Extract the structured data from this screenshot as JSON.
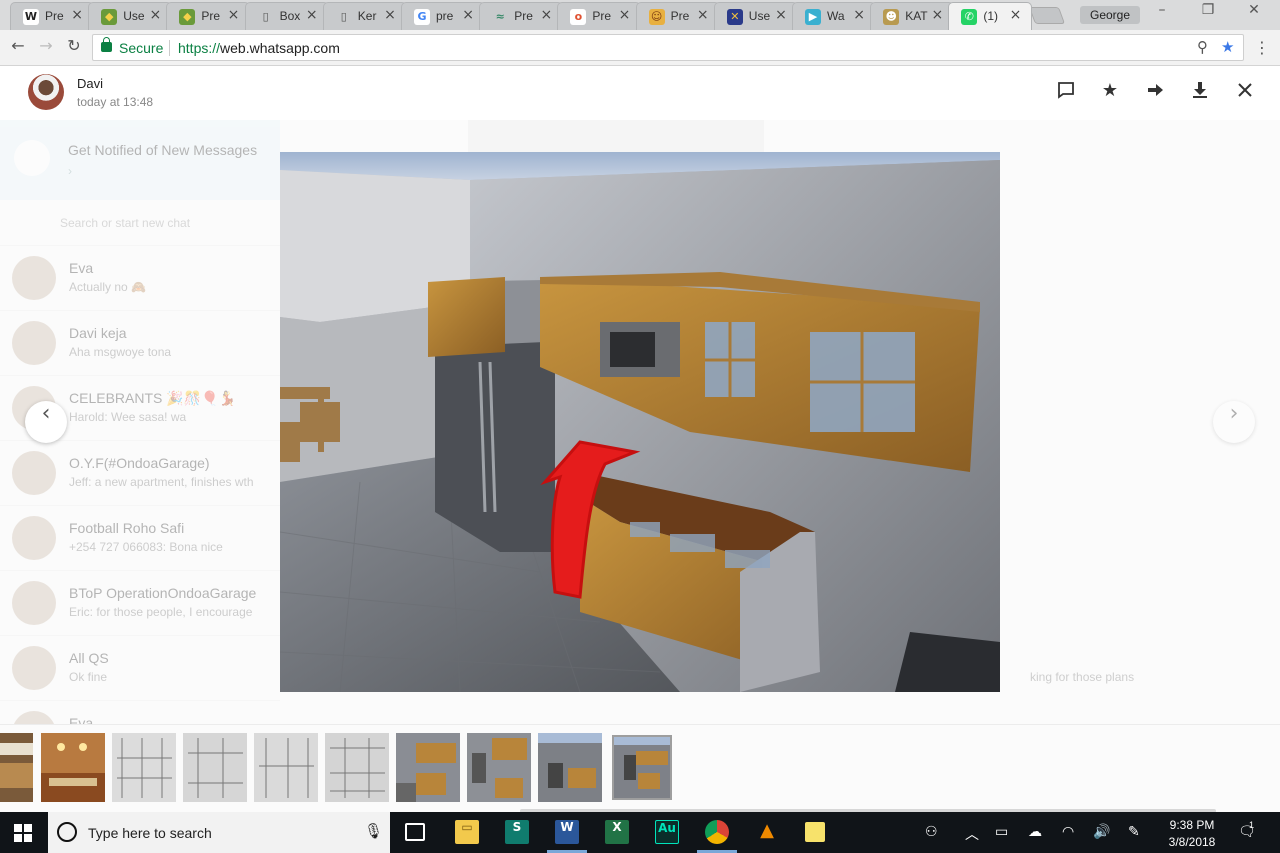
{
  "browser": {
    "tabs": [
      {
        "title": "Pre",
        "icon": "W",
        "color": "#ffffff",
        "fg": "#222222"
      },
      {
        "title": "Use",
        "icon": "◆",
        "color": "#6a9a3a",
        "fg": "#f4d04a"
      },
      {
        "title": "Pre",
        "icon": "◆",
        "color": "#6a9a3a",
        "fg": "#f4d04a"
      },
      {
        "title": "Box",
        "icon": "▯",
        "color": "#c8cacc",
        "fg": "#555555"
      },
      {
        "title": "Ker",
        "icon": "▯",
        "color": "#c8cacc",
        "fg": "#555555"
      },
      {
        "title": "pre",
        "icon": "G",
        "color": "#ffffff",
        "fg": "#4285f4"
      },
      {
        "title": "Pre",
        "icon": "≈",
        "color": "#c8cacc",
        "fg": "#3a8a6a"
      },
      {
        "title": "Pre",
        "icon": "o",
        "color": "#ffffff",
        "fg": "#e05030"
      },
      {
        "title": "Pre",
        "icon": "☺",
        "color": "#e8b040",
        "fg": "#7a3a10"
      },
      {
        "title": "Use",
        "icon": "✕",
        "color": "#2a3a8a",
        "fg": "#f0c040"
      },
      {
        "title": "Wa",
        "icon": "▶",
        "color": "#3ab0d0",
        "fg": "#ffffff"
      },
      {
        "title": "KAT",
        "icon": "☻",
        "color": "#b89a50",
        "fg": "#ffffff"
      },
      {
        "title": "(1)",
        "icon": "✆",
        "color": "#25d366",
        "fg": "#ffffff"
      }
    ],
    "active_tab_index": 12,
    "profile_name": "George",
    "secure_label": "Secure",
    "url_scheme": "https://",
    "url_host": "web.whatsapp.com",
    "bookmarked": true
  },
  "viewer": {
    "sender_name": "Davi",
    "sender_time": "today at 13:48",
    "actions": {
      "reply": "reply-icon",
      "star": "star-icon",
      "forward": "forward-icon",
      "download": "download-icon",
      "close": "close-icon"
    },
    "thumbnail_count": 10,
    "selected_thumbnail_index": 9
  },
  "background_chats": {
    "notification_title": "Get Notified of New Messages",
    "search_placeholder": "Search or start new chat",
    "chats": [
      {
        "name": "Eva",
        "preview": "Actually no 🙈"
      },
      {
        "name": "Davi keja",
        "preview": "Aha msgwoye tona"
      },
      {
        "name": "CELEBRANTS 🎉🎊🎈💃",
        "preview": "Harold: Wee sasa! wa"
      },
      {
        "name": "O.Y.F(#OndoaGarage)",
        "preview": "Jeff: a new apartment, finishes wth"
      },
      {
        "name": "Football Roho Safi",
        "preview": "+254 727 066083: Bona nice"
      },
      {
        "name": "BToP OperationOndoaGarage",
        "preview": "Eric: for those people, I encourage"
      },
      {
        "name": "All QS",
        "preview": "Ok fine"
      },
      {
        "name": "Eva",
        "preview": ""
      }
    ],
    "conversation_snippet": "king for those plans"
  },
  "taskbar": {
    "search_placeholder": "Type here to search",
    "time": "9:38 PM",
    "date": "3/8/2018",
    "notification_count": "1",
    "apps": [
      "task-view",
      "file-explorer",
      "sway",
      "word",
      "excel",
      "audition",
      "chrome",
      "vlc",
      "sticky-notes"
    ]
  }
}
